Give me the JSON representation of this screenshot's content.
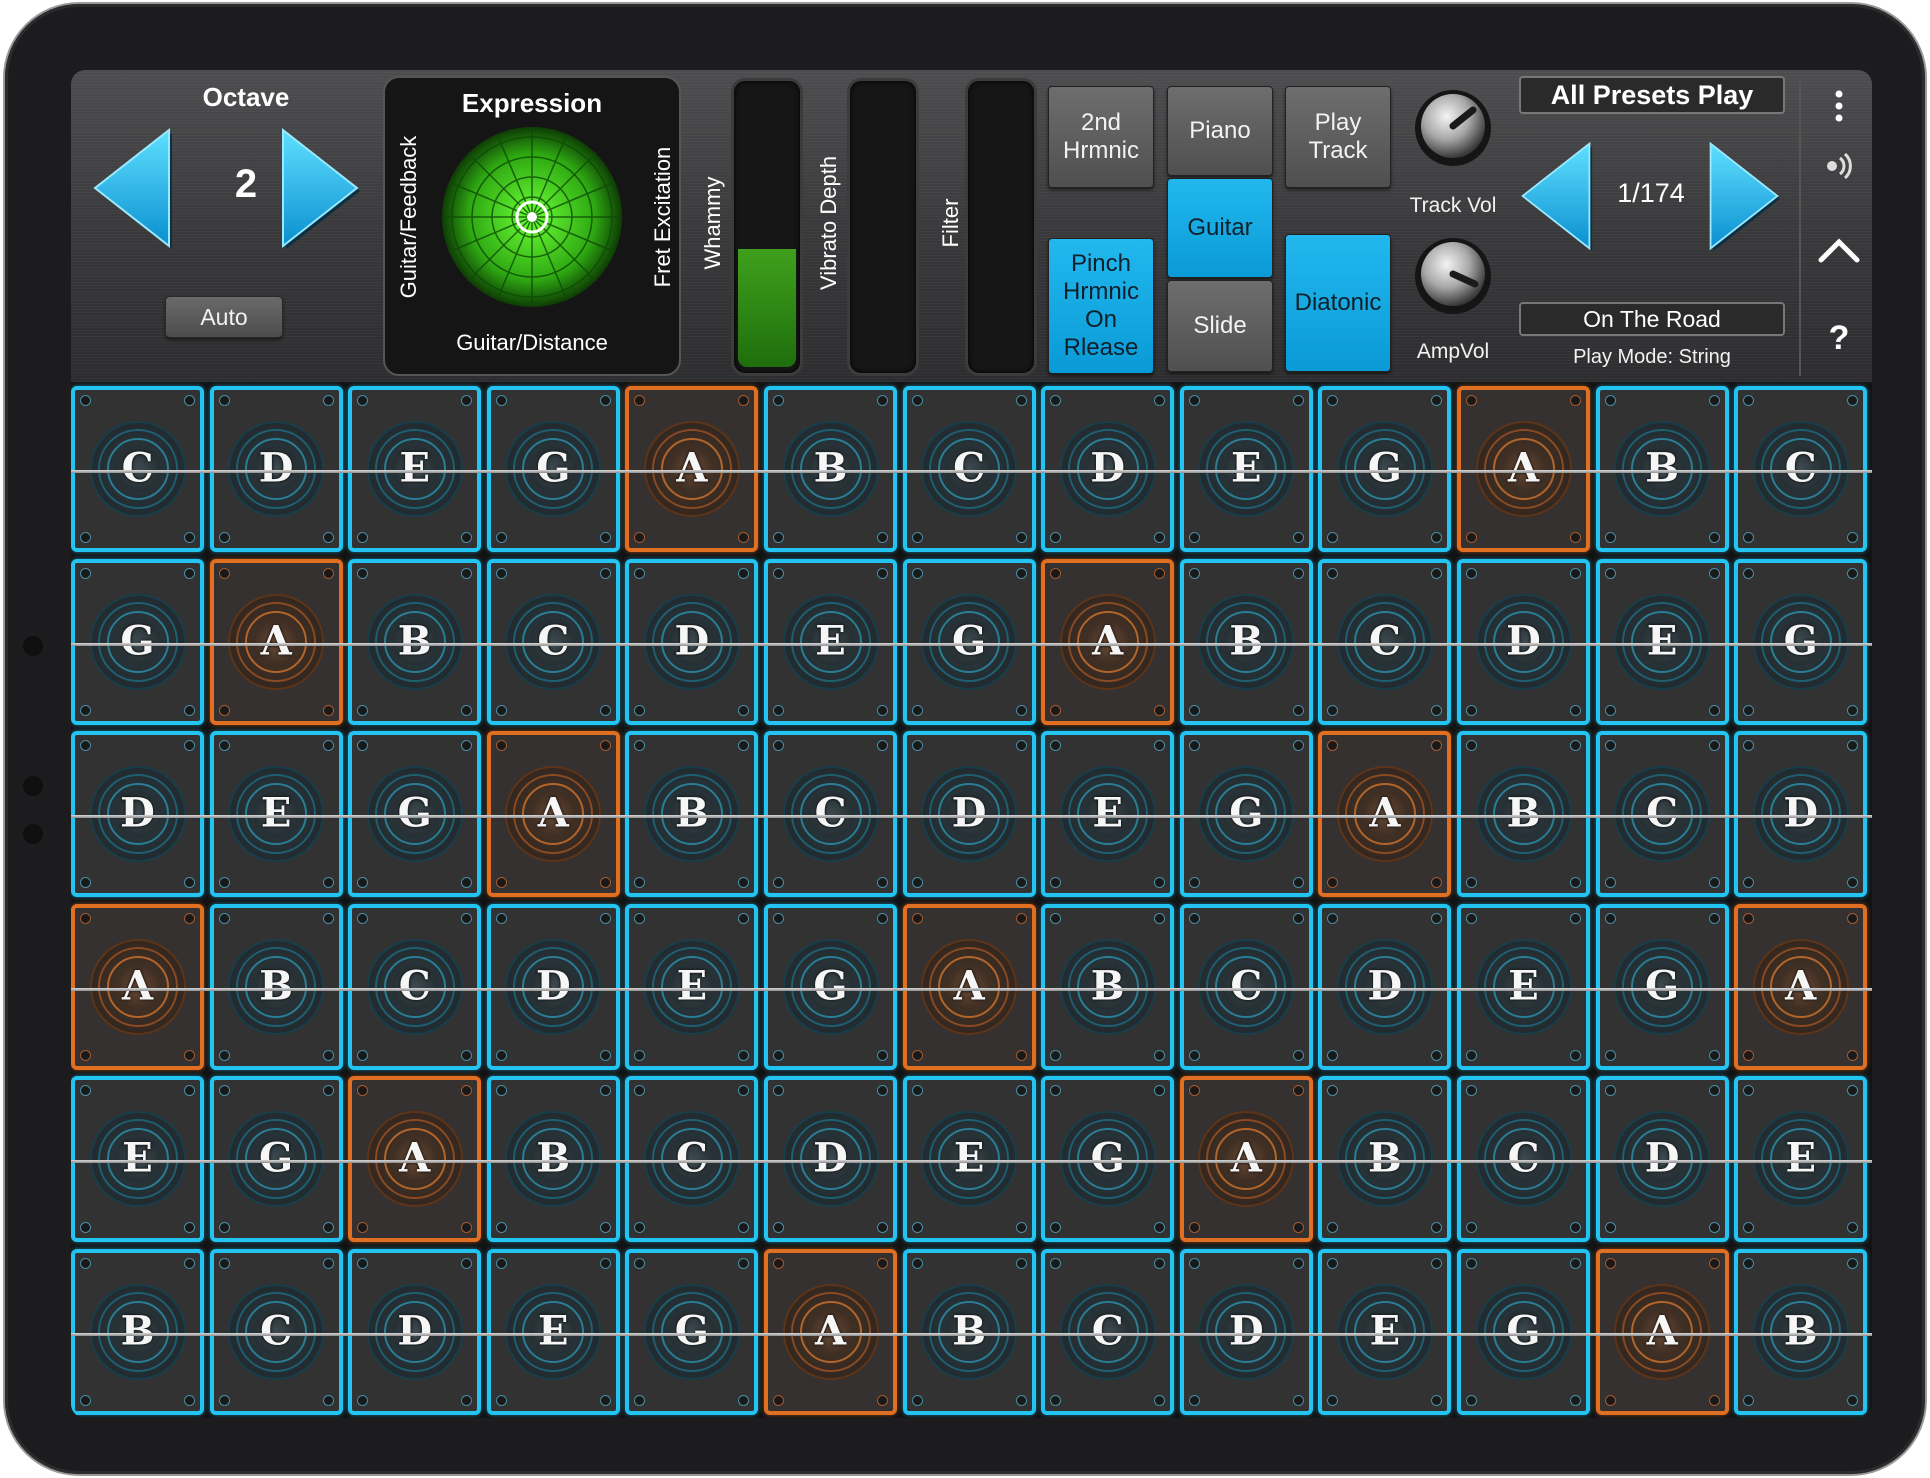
{
  "octave": {
    "title": "Octave",
    "value": "2",
    "auto_label": "Auto"
  },
  "expression": {
    "title": "Expression",
    "left_label": "Guitar/Feedback",
    "right_label": "Fret Excitation",
    "bottom_label": "Guitar/Distance"
  },
  "sliders": [
    {
      "label": "Whammy",
      "level": 0.42
    },
    {
      "label": "Vibrato Depth",
      "level": 0
    },
    {
      "label": "Filter",
      "level": 0
    }
  ],
  "mode_buttons": {
    "second_harmonic": "2nd\nHrmnic",
    "pinch_harmonic": "Pinch\nHrmnic\nOn\nRlease",
    "piano": "Piano",
    "guitar": "Guitar",
    "slide": "Slide",
    "play_track": "Play\nTrack",
    "diatonic": "Diatonic"
  },
  "knobs": {
    "track_vol": "Track Vol",
    "amp_vol": "AmpVol"
  },
  "presets": {
    "title": "All Presets Play",
    "position": "1/174",
    "name": "On The Road",
    "play_mode": "Play Mode: String"
  },
  "side_icons": [
    "more-vertical-icon",
    "broadcast-icon",
    "chevron-up-icon",
    "help-icon"
  ],
  "help_glyph": "?",
  "colors": {
    "cyan": "#23c4f2",
    "orange": "#e06f22",
    "green": "#3fa01c",
    "blue_button": "#12a8e4"
  },
  "grid": {
    "rows": [
      [
        "C",
        "D",
        "E",
        "G",
        "A",
        "B",
        "C",
        "D",
        "E",
        "G",
        "A",
        "B",
        "C"
      ],
      [
        "G",
        "A",
        "B",
        "C",
        "D",
        "E",
        "G",
        "A",
        "B",
        "C",
        "D",
        "E",
        "G"
      ],
      [
        "D",
        "E",
        "G",
        "A",
        "B",
        "C",
        "D",
        "E",
        "G",
        "A",
        "B",
        "C",
        "D"
      ],
      [
        "A",
        "B",
        "C",
        "D",
        "E",
        "G",
        "A",
        "B",
        "C",
        "D",
        "E",
        "G",
        "A"
      ],
      [
        "E",
        "G",
        "A",
        "B",
        "C",
        "D",
        "E",
        "G",
        "A",
        "B",
        "C",
        "D",
        "E"
      ],
      [
        "B",
        "C",
        "D",
        "E",
        "G",
        "A",
        "B",
        "C",
        "D",
        "E",
        "G",
        "A",
        "B"
      ]
    ],
    "highlight_note": "A"
  }
}
